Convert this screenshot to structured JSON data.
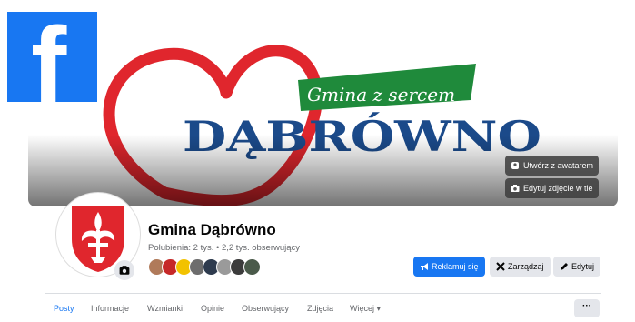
{
  "brand": {
    "logo_letter": "f",
    "color": "#1877f2"
  },
  "cover": {
    "slogan": "Gmina z sercem",
    "town": "DĄBRÓWNO",
    "create_avatar_label": "Utwórz z awatarem",
    "edit_cover_label": "Edytuj zdjęcie w tle"
  },
  "page": {
    "name": "Gmina Dąbrówno",
    "stats": "Polubienia: 2 tys. • 2,2 tys. obserwujący"
  },
  "actions": {
    "promote": "Reklamuj się",
    "manage": "Zarządzaj",
    "edit": "Edytuj"
  },
  "tabs": [
    "Posty",
    "Informacje",
    "Wzmianki",
    "Opinie",
    "Obserwujący",
    "Zdjęcia",
    "Więcej ▾"
  ],
  "more_label": "···",
  "colors": {
    "accent": "#1877f2",
    "heart": "#e0262d",
    "slogan_bg": "#1f8a3b",
    "town": "#1b4a8a"
  }
}
